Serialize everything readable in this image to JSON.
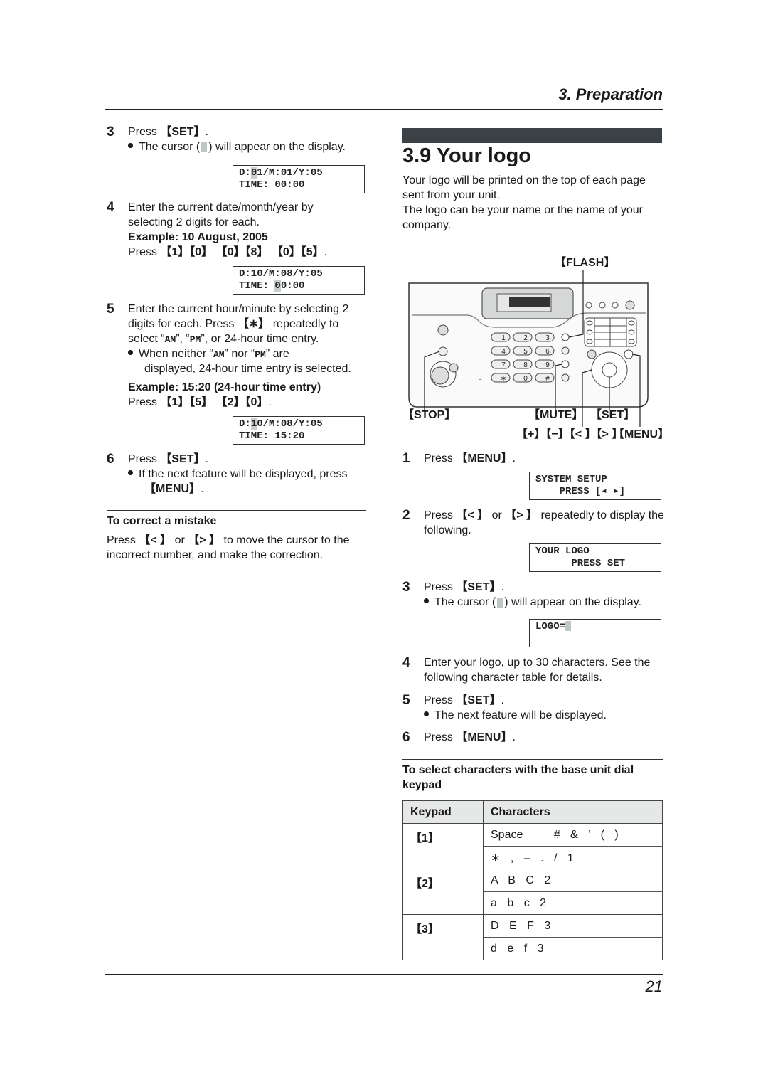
{
  "header": {
    "section": "3. Preparation"
  },
  "footer": {
    "page_number": "21"
  },
  "left": {
    "step3": {
      "num": "3",
      "text_prefix": "Press ",
      "key": "【SET】",
      "text_suffix": ".",
      "bullet_prefix": "The cursor (",
      "bullet_suffix": ") will appear on the display."
    },
    "lcd1": {
      "line1_a": "D:",
      "line1_hl": "0",
      "line1_b": "1/M:01/Y:05",
      "line2": "TIME: 00:00"
    },
    "step4": {
      "num": "4",
      "line1": "Enter the current date/month/year by",
      "line2": "selecting 2 digits for each.",
      "example": "Example: 10 August, 2005",
      "press_prefix": "Press ",
      "press_keys": "【1】【0】 【0】【8】 【0】【5】",
      "press_suffix": "."
    },
    "lcd2": {
      "line1": "D:10/M:08/Y:05",
      "line2_a": "TIME: ",
      "line2_hl": "0",
      "line2_b": "0:00"
    },
    "step5": {
      "num": "5",
      "line1": "Enter the current hour/minute by selecting 2",
      "line2_prefix": "digits for each. Press ",
      "line2_key": "【∗】",
      "line2_suffix": " repeatedly to",
      "line3_a": "select “",
      "am": "AM",
      "line3_b": "”, “",
      "pm": "PM",
      "line3_c": "”, or 24-hour time entry.",
      "bullet1_a": "When neither “",
      "bullet1_b": "” nor “",
      "bullet1_c": "” are",
      "bullet2": "displayed, 24-hour time entry is selected.",
      "example": "Example: 15:20 (24-hour time entry)",
      "press_prefix": "Press ",
      "press_keys": "【1】【5】 【2】【0】",
      "press_suffix": "."
    },
    "lcd3": {
      "line1_a": "D:",
      "line1_hl": "1",
      "line1_b": "0/M:08/Y:05",
      "line2": "TIME: 15:20"
    },
    "step6": {
      "num": "6",
      "text_prefix": "Press ",
      "key": "【SET】",
      "text_suffix": ".",
      "bullet1": "If the next feature will be displayed, press",
      "bullet2_key": "【MENU】",
      "bullet2_suffix": "."
    },
    "correct": {
      "heading": "To correct a mistake",
      "line1_a": "Press ",
      "k1": "【< 】",
      "line1_b": " or ",
      "k2": "【> 】",
      "line1_c": " to move the cursor to the",
      "line2": "incorrect number, and make the correction."
    }
  },
  "right": {
    "title": "3.9 Your logo",
    "intro1": "Your logo will be printed on the top of each page",
    "intro2": "sent from your unit.",
    "intro3": "The logo can be your name or the name of your",
    "intro4": "company.",
    "panel": {
      "flash": "【FLASH】",
      "stop": "【STOP】",
      "mute": "【MUTE】",
      "set": "【SET】",
      "nav": "【+】【−】【< 】【> 】",
      "menu": "【MENU】",
      "keys": [
        "1",
        "2",
        "3",
        "4",
        "5",
        "6",
        "7",
        "8",
        "9",
        "∗",
        "0",
        "#"
      ]
    },
    "step1": {
      "num": "1",
      "text_prefix": "Press ",
      "key": "【MENU】",
      "text_suffix": "."
    },
    "lcd1": {
      "line1": "SYSTEM SETUP",
      "line2": "    PRESS [◂ ▸]"
    },
    "step2": {
      "num": "2",
      "line1_a": "Press ",
      "k1": "【< 】",
      "line1_b": " or ",
      "k2": "【> 】",
      "line1_c": " repeatedly to display the",
      "line2": "following."
    },
    "lcd2": {
      "line1": "YOUR LOGO",
      "line2": "      PRESS SET"
    },
    "step3": {
      "num": "3",
      "text_prefix": "Press ",
      "key": "【SET】",
      "text_suffix": ".",
      "bullet_prefix": "The cursor (",
      "bullet_suffix": ") will appear on the display."
    },
    "lcd3": {
      "line1": "LOGO="
    },
    "step4": {
      "num": "4",
      "line1": "Enter your logo, up to 30 characters. See the",
      "line2": "following character table for details."
    },
    "step5": {
      "num": "5",
      "text_prefix": "Press ",
      "key": "【SET】",
      "text_suffix": ".",
      "bullet": "The next feature will be displayed."
    },
    "step6": {
      "num": "6",
      "text_prefix": "Press ",
      "key": "【MENU】",
      "text_suffix": "."
    },
    "table_heading1": "To select characters with the base unit dial",
    "table_heading2": "keypad",
    "table": {
      "headers": [
        "Keypad",
        "Characters"
      ],
      "rows": [
        {
          "key": "【1】",
          "chars": [
            "Space   # & ’ ( )",
            "∗ , – . / 1"
          ]
        },
        {
          "key": "【2】",
          "chars": [
            "A B C 2",
            "a b c 2"
          ]
        },
        {
          "key": "【3】",
          "chars": [
            "D E F 3",
            "d e f 3"
          ]
        }
      ]
    }
  }
}
